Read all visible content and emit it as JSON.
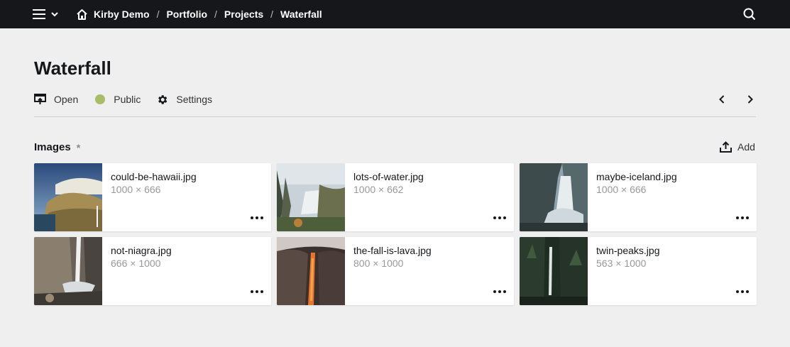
{
  "topbar": {
    "menu_icon": "hamburger-icon",
    "menu_chevron_icon": "chevron-down-icon",
    "home_icon": "home-icon",
    "search_icon": "search-icon",
    "breadcrumb": [
      "Kirby Demo",
      "Portfolio",
      "Projects",
      "Waterfall"
    ],
    "separator": "/"
  },
  "page": {
    "title": "Waterfall",
    "actions": {
      "open": {
        "label": "Open",
        "icon": "open-icon"
      },
      "status": {
        "label": "Public",
        "icon": "status-dot-icon",
        "color": "#a7bd68"
      },
      "settings": {
        "label": "Settings",
        "icon": "gear-icon"
      }
    },
    "pager": {
      "prev_icon": "chevron-left-icon",
      "next_icon": "chevron-right-icon"
    }
  },
  "section": {
    "title": "Images",
    "required_marker": "*",
    "add_label": "Add",
    "add_icon": "upload-icon",
    "files": [
      {
        "name": "could-be-hawaii.jpg",
        "dims": "1000 × 666"
      },
      {
        "name": "lots-of-water.jpg",
        "dims": "1000 × 662"
      },
      {
        "name": "maybe-iceland.jpg",
        "dims": "1000 × 666"
      },
      {
        "name": "not-niagra.jpg",
        "dims": "666 × 1000"
      },
      {
        "name": "the-fall-is-lava.jpg",
        "dims": "800 × 1000"
      },
      {
        "name": "twin-peaks.jpg",
        "dims": "563 × 1000"
      }
    ]
  },
  "colors": {
    "topbar": "#16171a",
    "background": "#efefef",
    "status_public": "#a7bd68",
    "muted_text": "#999999"
  }
}
